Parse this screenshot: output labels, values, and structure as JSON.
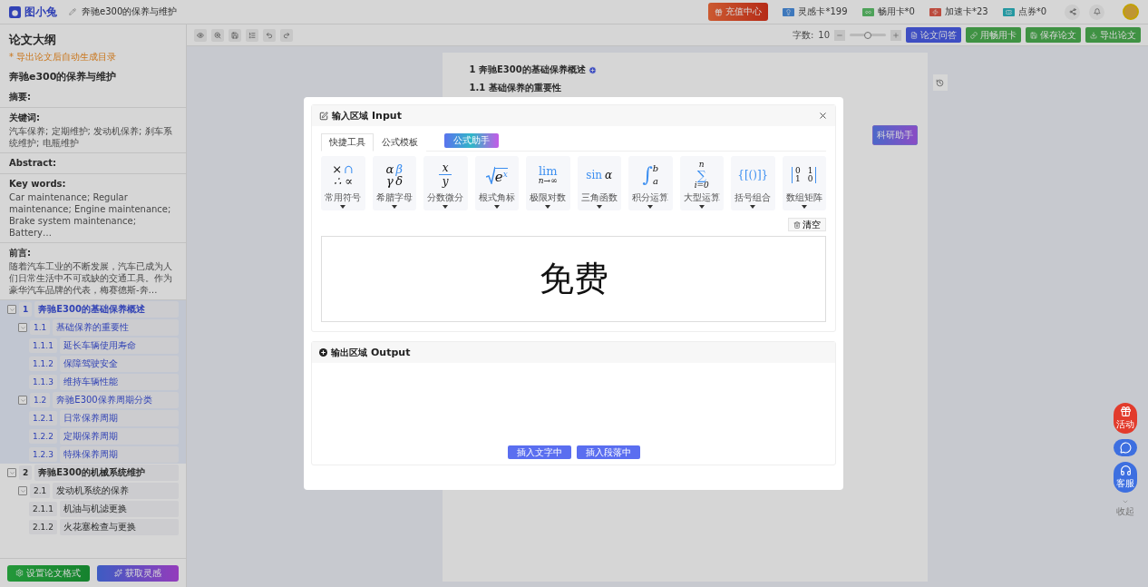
{
  "header": {
    "logo_text": "图小兔",
    "doc_title": "奔驰e300的保养与维护",
    "recharge": "充值中心",
    "cards": [
      {
        "label": "灵感卡*199"
      },
      {
        "label": "畅用卡*0"
      },
      {
        "label": "加速卡*23"
      },
      {
        "label": "点券*0"
      }
    ]
  },
  "toolbar": {
    "word_count_label": "字数:",
    "word_count": "10",
    "zoom": {
      "level": 0.5
    },
    "buttons": [
      {
        "label": "论文问答",
        "kind": "primary"
      },
      {
        "label": "用畅用卡",
        "kind": "success"
      },
      {
        "label": "保存论文",
        "kind": "success"
      },
      {
        "label": "导出论文",
        "kind": "success"
      }
    ]
  },
  "sidebar": {
    "title": "论文大纲",
    "hint": "* 导出论文后自动生成目录",
    "paper_title": "奔驰e300的保养与维护",
    "sections": [
      {
        "heading": "摘要:"
      },
      {
        "heading": "关键词:",
        "text": "汽车保养; 定期维护; 发动机保养; 刹车系统维护; 电瓶维护"
      },
      {
        "heading": "Abstract:"
      },
      {
        "heading": "Key words:",
        "text": "Car maintenance; Regular maintenance; Engine maintenance; Brake system maintenance; Battery…"
      },
      {
        "heading": "前言:",
        "text": "随着汽车工业的不断发展，汽车已成为人们日常生活中不可或缺的交通工具。作为豪华汽车品牌的代表，梅赛德斯-奔…"
      }
    ],
    "outline": [
      {
        "number": "1",
        "title": "奔驰E300的基础保养概述",
        "selected": true,
        "expanded": true,
        "children": [
          {
            "number": "1.1",
            "title": "基础保养的重要性",
            "expanded": true,
            "children": [
              {
                "number": "1.1.1",
                "title": "延长车辆使用寿命"
              },
              {
                "number": "1.1.2",
                "title": "保障驾驶安全"
              },
              {
                "number": "1.1.3",
                "title": "维持车辆性能"
              }
            ]
          },
          {
            "number": "1.2",
            "title": "奔驰E300保养周期分类",
            "expanded": true,
            "children": [
              {
                "number": "1.2.1",
                "title": "日常保养周期"
              },
              {
                "number": "1.2.2",
                "title": "定期保养周期"
              },
              {
                "number": "1.2.3",
                "title": "特殊保养周期"
              }
            ]
          }
        ]
      },
      {
        "number": "2",
        "title": "奔驰E300的机械系统维护",
        "selected": false,
        "expanded": true,
        "children": [
          {
            "number": "2.1",
            "title": "发动机系统的保养",
            "expanded": true,
            "children": [
              {
                "number": "2.1.1",
                "title": "机油与机滤更换"
              },
              {
                "number": "2.1.2",
                "title": "火花塞检查与更换"
              }
            ]
          }
        ]
      }
    ],
    "footer_buttons": [
      {
        "label": "设置论文格式",
        "kind": "green"
      },
      {
        "label": "获取灵感",
        "kind": "gradient"
      }
    ]
  },
  "document": {
    "heading": "1 奔驰E300的基础保养概述",
    "subheading": "1.1 基础保养的重要性",
    "assistant_button": "科研助手"
  },
  "modal": {
    "title": "输入区域",
    "title_en": "Input",
    "tabs": [
      {
        "label": "快捷工具",
        "selected": true
      },
      {
        "label": "公式模板",
        "selected": false
      }
    ],
    "assistant": "公式助手",
    "tools": [
      {
        "kind": "grid",
        "parts": [
          "×",
          "∩",
          "∴",
          "∝"
        ],
        "caption": "常用符号"
      },
      {
        "kind": "grid",
        "parts": [
          "α",
          "β",
          "γ",
          "δ"
        ],
        "caption": "希腊字母"
      },
      {
        "kind": "fraction",
        "parts": [
          "x",
          "y"
        ],
        "caption": "分数微分"
      },
      {
        "kind": "root",
        "parts": [
          "e",
          "x"
        ],
        "caption": "根式角标"
      },
      {
        "kind": "limit",
        "parts": [
          "lim",
          "n→∞"
        ],
        "caption": "极限对数"
      },
      {
        "kind": "inline",
        "parts": [
          "sin",
          "α"
        ],
        "caption": "三角函数"
      },
      {
        "kind": "integral",
        "parts": [
          "∫",
          "b",
          "a"
        ],
        "caption": "积分运算"
      },
      {
        "kind": "sum",
        "parts": [
          "n",
          "∑",
          "i=0"
        ],
        "caption": "大型运算"
      },
      {
        "kind": "inline",
        "parts": [
          "{[()]}"
        ],
        "caption": "括号组合"
      },
      {
        "kind": "matrix",
        "parts": [
          "0",
          "1",
          "1",
          "0"
        ],
        "caption": "数组矩阵"
      }
    ],
    "clear": "清空",
    "canvas_text": "免费",
    "output_title": "输出区域",
    "output_title_en": "Output",
    "output_buttons": [
      "插入文字中",
      "插入段落中"
    ]
  },
  "float": {
    "gift_label": "活动",
    "service_label": "客服",
    "collapse": "收起"
  }
}
